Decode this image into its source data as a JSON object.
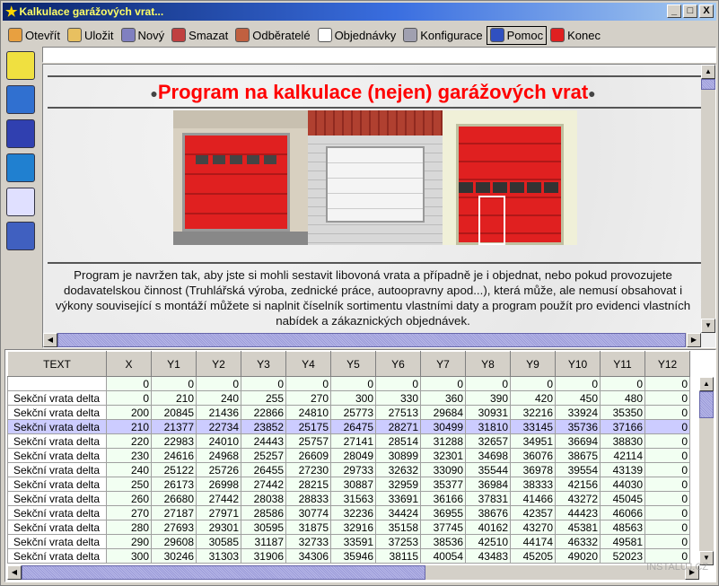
{
  "window": {
    "title": "Kalkulace garážových vrat...",
    "min": "_",
    "max": "□",
    "close": "X"
  },
  "toolbar": [
    {
      "label": "Otevřít",
      "icon": "open-folder-icon",
      "color": "#e8a040"
    },
    {
      "label": "Uložit",
      "icon": "save-folder-icon",
      "color": "#e8c060"
    },
    {
      "label": "Nový",
      "icon": "new-book-icon",
      "color": "#8080c0"
    },
    {
      "label": "Smazat",
      "icon": "delete-book-icon",
      "color": "#c04040"
    },
    {
      "label": "Odběratelé",
      "icon": "customers-icon",
      "color": "#c06040"
    },
    {
      "label": "Objednávky",
      "icon": "orders-icon",
      "color": "#ffffff"
    },
    {
      "label": "Konfigurace",
      "icon": "gear-icon",
      "color": "#a0a0b0"
    },
    {
      "label": "Pomoc",
      "icon": "help-icon",
      "color": "#3050c0"
    },
    {
      "label": "Konec",
      "icon": "exit-icon",
      "color": "#e02020"
    }
  ],
  "sidebar": [
    {
      "icon": "funnel-icon",
      "color": "#f0e040"
    },
    {
      "icon": "globe-icon",
      "color": "#3070d0"
    },
    {
      "icon": "device-icon",
      "color": "#3040b0"
    },
    {
      "icon": "resize-icon",
      "color": "#2080d0"
    },
    {
      "icon": "delete-document-icon",
      "color": "#e0e0ff"
    },
    {
      "icon": "settings-window-icon",
      "color": "#4060c0"
    }
  ],
  "content": {
    "heading": "Program na kalkulace (nejen) garážových vrat",
    "paragraph": "Program je navržen tak, aby jste si mohli sestavit libovoná vrata a případně je i objednat, nebo pokud provozujete dodavatelskou činnost (Truhlářská výroba, zednické práce, autoopravny apod...), která může, ale nemusí obsahovat i výkony související s montáží můžete si naplnit číselník sortimentu vlastními daty a program použít pro evidenci vlastních nabídek a zákaznických objednávek."
  },
  "table": {
    "columns": [
      "TEXT",
      "X",
      "Y1",
      "Y2",
      "Y3",
      "Y4",
      "Y5",
      "Y6",
      "Y7",
      "Y8",
      "Y9",
      "Y10",
      "Y11",
      "Y12"
    ],
    "selected_row": 3,
    "rows": [
      [
        "",
        "0",
        "0",
        "0",
        "0",
        "0",
        "0",
        "0",
        "0",
        "0",
        "0",
        "0",
        "0",
        "0"
      ],
      [
        "Sekční vrata delta",
        "0",
        "210",
        "240",
        "255",
        "270",
        "300",
        "330",
        "360",
        "390",
        "420",
        "450",
        "480",
        "0"
      ],
      [
        "Sekční vrata delta",
        "200",
        "20845",
        "21436",
        "22866",
        "24810",
        "25773",
        "27513",
        "29684",
        "30931",
        "32216",
        "33924",
        "35350",
        "0"
      ],
      [
        "Sekční vrata delta",
        "210",
        "21377",
        "22734",
        "23852",
        "25175",
        "26475",
        "28271",
        "30499",
        "31810",
        "33145",
        "35736",
        "37166",
        "0"
      ],
      [
        "Sekční vrata delta",
        "220",
        "22983",
        "24010",
        "24443",
        "25757",
        "27141",
        "28514",
        "31288",
        "32657",
        "34951",
        "36694",
        "38830",
        "0"
      ],
      [
        "Sekční vrata delta",
        "230",
        "24616",
        "24968",
        "25257",
        "26609",
        "28049",
        "30899",
        "32301",
        "34698",
        "36076",
        "38675",
        "42114",
        "0"
      ],
      [
        "Sekční vrata delta",
        "240",
        "25122",
        "25726",
        "26455",
        "27230",
        "29733",
        "32632",
        "33090",
        "35544",
        "36978",
        "39554",
        "43139",
        "0"
      ],
      [
        "Sekční vrata delta",
        "250",
        "26173",
        "26998",
        "27442",
        "28215",
        "30887",
        "32959",
        "35377",
        "36984",
        "38333",
        "42156",
        "44030",
        "0"
      ],
      [
        "Sekční vrata delta",
        "260",
        "26680",
        "27442",
        "28038",
        "28833",
        "31563",
        "33691",
        "36166",
        "37831",
        "41466",
        "43272",
        "45045",
        "0"
      ],
      [
        "Sekční vrata delta",
        "270",
        "27187",
        "27971",
        "28586",
        "30774",
        "32236",
        "34424",
        "36955",
        "38676",
        "42357",
        "44423",
        "46066",
        "0"
      ],
      [
        "Sekční vrata delta",
        "280",
        "27693",
        "29301",
        "30595",
        "31875",
        "32916",
        "35158",
        "37745",
        "40162",
        "43270",
        "45381",
        "48563",
        "0"
      ],
      [
        "Sekční vrata delta",
        "290",
        "29608",
        "30585",
        "31187",
        "32733",
        "33591",
        "37253",
        "38536",
        "42510",
        "44174",
        "46332",
        "49581",
        "0"
      ],
      [
        "Sekční vrata delta",
        "300",
        "30246",
        "31303",
        "31906",
        "34306",
        "35946",
        "38115",
        "40054",
        "43483",
        "45205",
        "49020",
        "52023",
        "0"
      ]
    ]
  },
  "watermark": "INSTALUJ.CZ"
}
